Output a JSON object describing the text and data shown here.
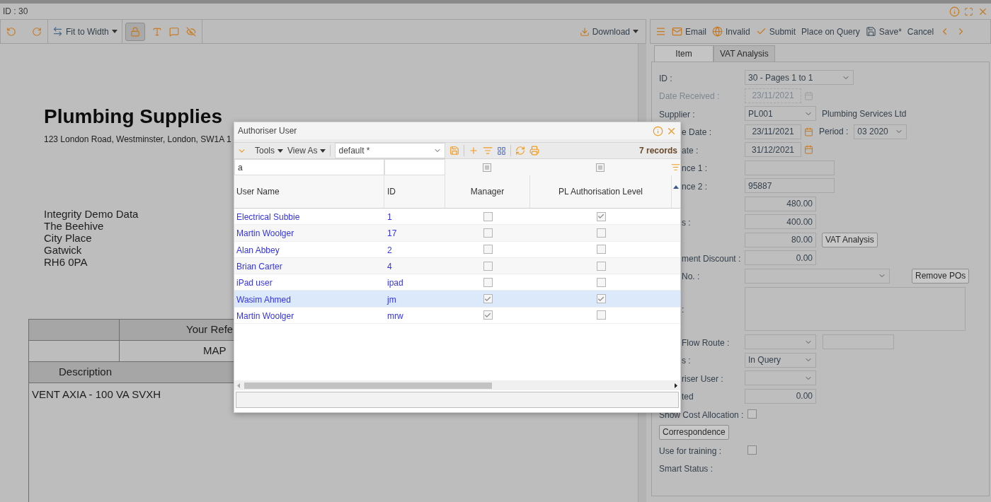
{
  "window": {
    "title": "ID : 30"
  },
  "viewer": {
    "toolbar": {
      "fit_button": "Fit to Width",
      "lock_pressed": true,
      "download_button": "Download"
    },
    "document": {
      "company": "Plumbing Supplies",
      "address": "123 London Road, Westminster, London, SW1A 1",
      "recipient_lines": [
        "Integrity Demo Data",
        "The Beehive",
        "City Place",
        "Gatwick",
        "RH6 0PA"
      ],
      "reference_header": "Your Refe",
      "reference_value": "MAP",
      "description_header": "Description",
      "item": "VENT AXIA - 100 VA SVXH"
    }
  },
  "form": {
    "toolbar": [
      {
        "kind": "menu"
      },
      {
        "kind": "email",
        "label": "Email"
      },
      {
        "kind": "invalid",
        "label": "Invalid"
      },
      {
        "kind": "submit",
        "label": "Submit"
      },
      {
        "kind": "plain",
        "label": "Place on Query"
      },
      {
        "kind": "save",
        "label": "Save*"
      },
      {
        "kind": "plain",
        "label": "Cancel"
      },
      {
        "kind": "prev"
      },
      {
        "kind": "next"
      }
    ],
    "tabs": [
      {
        "label": "Item",
        "selected": true
      },
      {
        "label": "VAT Analysis",
        "selected": false
      }
    ],
    "rows": [
      {
        "kind": "field",
        "label": "ID :",
        "controls": [
          {
            "kind": "select",
            "value": "30 - Pages 1 to 1"
          }
        ]
      },
      {
        "kind": "field",
        "label": "Date Received :",
        "disabled": true,
        "controls": [
          {
            "kind": "date",
            "value": "23/11/2021"
          }
        ]
      },
      {
        "kind": "field",
        "label": "Supplier :",
        "controls": [
          {
            "kind": "select",
            "value": "PL001"
          },
          {
            "kind": "static",
            "value": "Plumbing Services Ltd"
          }
        ]
      },
      {
        "kind": "field",
        "label": "e Date :",
        "partly_hidden": true,
        "controls": [
          {
            "kind": "date",
            "value": "23/11/2021"
          },
          {
            "kind": "static",
            "value": "Period :"
          },
          {
            "kind": "select",
            "value": "03 2020"
          }
        ]
      },
      {
        "kind": "field",
        "label": "ate :",
        "partly_hidden": true,
        "controls": [
          {
            "kind": "date",
            "value": "31/12/2021"
          }
        ]
      },
      {
        "kind": "field",
        "label": "nce 1 :",
        "partly_hidden": true,
        "controls": [
          {
            "kind": "text"
          }
        ]
      },
      {
        "kind": "field",
        "label": "nce 2 :",
        "partly_hidden": true,
        "controls": [
          {
            "kind": "text",
            "value": "95887"
          }
        ]
      },
      {
        "kind": "field",
        "controls": [
          {
            "kind": "number",
            "value": "480.00"
          }
        ]
      },
      {
        "kind": "field",
        "label": "s :",
        "partly_hidden": true,
        "controls": [
          {
            "kind": "number",
            "value": "400.00"
          }
        ]
      },
      {
        "kind": "field",
        "controls": [
          {
            "kind": "number",
            "value": "80.00"
          },
          {
            "kind": "button",
            "value": "VAT Analysis"
          }
        ]
      },
      {
        "kind": "field",
        "label": "ment Discount :",
        "partly_hidden": true,
        "controls": [
          {
            "kind": "number",
            "value": "0.00"
          }
        ]
      },
      {
        "kind": "field",
        "label": "No. :",
        "partly_hidden": true,
        "controls": [
          {
            "kind": "select"
          },
          {
            "kind": "button",
            "value": "Remove POs"
          }
        ]
      },
      {
        "kind": "field",
        "label": ":",
        "partly_hidden": true,
        "controls": [
          {
            "kind": "textarea"
          }
        ]
      },
      {
        "kind": "field",
        "label": "Flow Route :",
        "partly_hidden": true,
        "controls": [
          {
            "kind": "select"
          },
          {
            "kind": "text"
          }
        ]
      },
      {
        "kind": "field",
        "label": "s :",
        "partly_hidden": true,
        "controls": [
          {
            "kind": "select",
            "value": "In Query"
          }
        ]
      },
      {
        "kind": "field",
        "label": "riser User :",
        "partly_hidden": true,
        "controls": [
          {
            "kind": "select"
          }
        ]
      },
      {
        "kind": "field",
        "label": "ted",
        "partly_hidden": true,
        "controls": [
          {
            "kind": "number",
            "value": "0.00"
          }
        ]
      },
      {
        "kind": "field",
        "label": "Show Cost Allocation :",
        "controls": [
          {
            "kind": "checkbox",
            "checked": false
          }
        ]
      },
      {
        "kind": "action",
        "label": "Correspondence"
      },
      {
        "kind": "field",
        "label": "Use for training :",
        "controls": [
          {
            "kind": "checkbox",
            "checked": false
          }
        ]
      },
      {
        "kind": "field",
        "label": "Smart Status :",
        "controls": []
      }
    ]
  },
  "dialog": {
    "title": "Authoriser User",
    "tools_menu": "Tools",
    "view_as_menu": "View As",
    "view_select": "default *",
    "record_count": "7 records",
    "user_name_filter": "a",
    "manager_filter_indeterminate": true,
    "pl_filter_indeterminate": true,
    "columns": [
      "User Name",
      "ID",
      "Manager",
      "PL Authorisation Level"
    ],
    "rows": [
      {
        "user_name": "Electrical Subbie",
        "id": "1",
        "manager": false,
        "pl_authorisation": true,
        "selected": false
      },
      {
        "user_name": "Martin Woolger",
        "id": "17",
        "manager": false,
        "pl_authorisation": false,
        "selected": false
      },
      {
        "user_name": "Alan Abbey",
        "id": "2",
        "manager": false,
        "pl_authorisation": false,
        "selected": false
      },
      {
        "user_name": "Brian Carter",
        "id": "4",
        "manager": false,
        "pl_authorisation": false,
        "selected": false
      },
      {
        "user_name": "iPad user",
        "id": "ipad",
        "manager": false,
        "pl_authorisation": false,
        "selected": false
      },
      {
        "user_name": "Wasim Ahmed",
        "id": "jm",
        "manager": true,
        "pl_authorisation": true,
        "selected": true
      },
      {
        "user_name": "Martin Woolger",
        "id": "mrw",
        "manager": true,
        "pl_authorisation": false,
        "selected": false
      }
    ]
  }
}
